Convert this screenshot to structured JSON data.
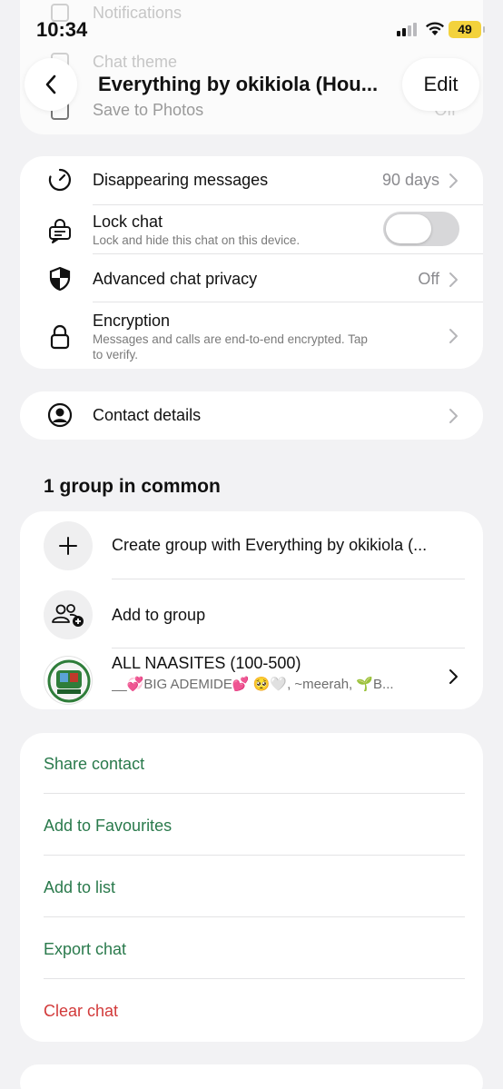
{
  "status_bar": {
    "time": "10:34",
    "battery": "49"
  },
  "ghost": {
    "items": [
      "Notifications",
      "Chat theme",
      "Save to Photos"
    ],
    "save_value": "Off"
  },
  "header": {
    "title": "Everything by okikiola (Hou...",
    "edit_label": "Edit"
  },
  "privacy": {
    "disappearing": {
      "label": "Disappearing messages",
      "value": "90 days"
    },
    "lock": {
      "label": "Lock chat",
      "sub": "Lock and hide this chat on this device.",
      "enabled": false
    },
    "advanced": {
      "label": "Advanced chat privacy",
      "value": "Off"
    },
    "encryption": {
      "label": "Encryption",
      "sub1": "Messages and calls are end-to-end encrypted. Tap",
      "sub2": "to verify."
    }
  },
  "contact_details_label": "Contact details",
  "groups": {
    "title": "1 group in common",
    "create_label": "Create group with Everything by okikiola (...",
    "add_label": "Add to group",
    "group_name": "ALL NAASITES (100-500)",
    "group_members": "__💞BIG ADEMIDE💕 🥺🤍, ~meerah, 🌱B..."
  },
  "actions": {
    "share": "Share contact",
    "favourites": "Add to Favourites",
    "list": "Add to list",
    "export": "Export chat",
    "clear": "Clear chat"
  },
  "colors": {
    "accent_green": "#2a7a4c",
    "danger_red": "#d23a3a",
    "battery_yellow": "#f3d23c"
  }
}
